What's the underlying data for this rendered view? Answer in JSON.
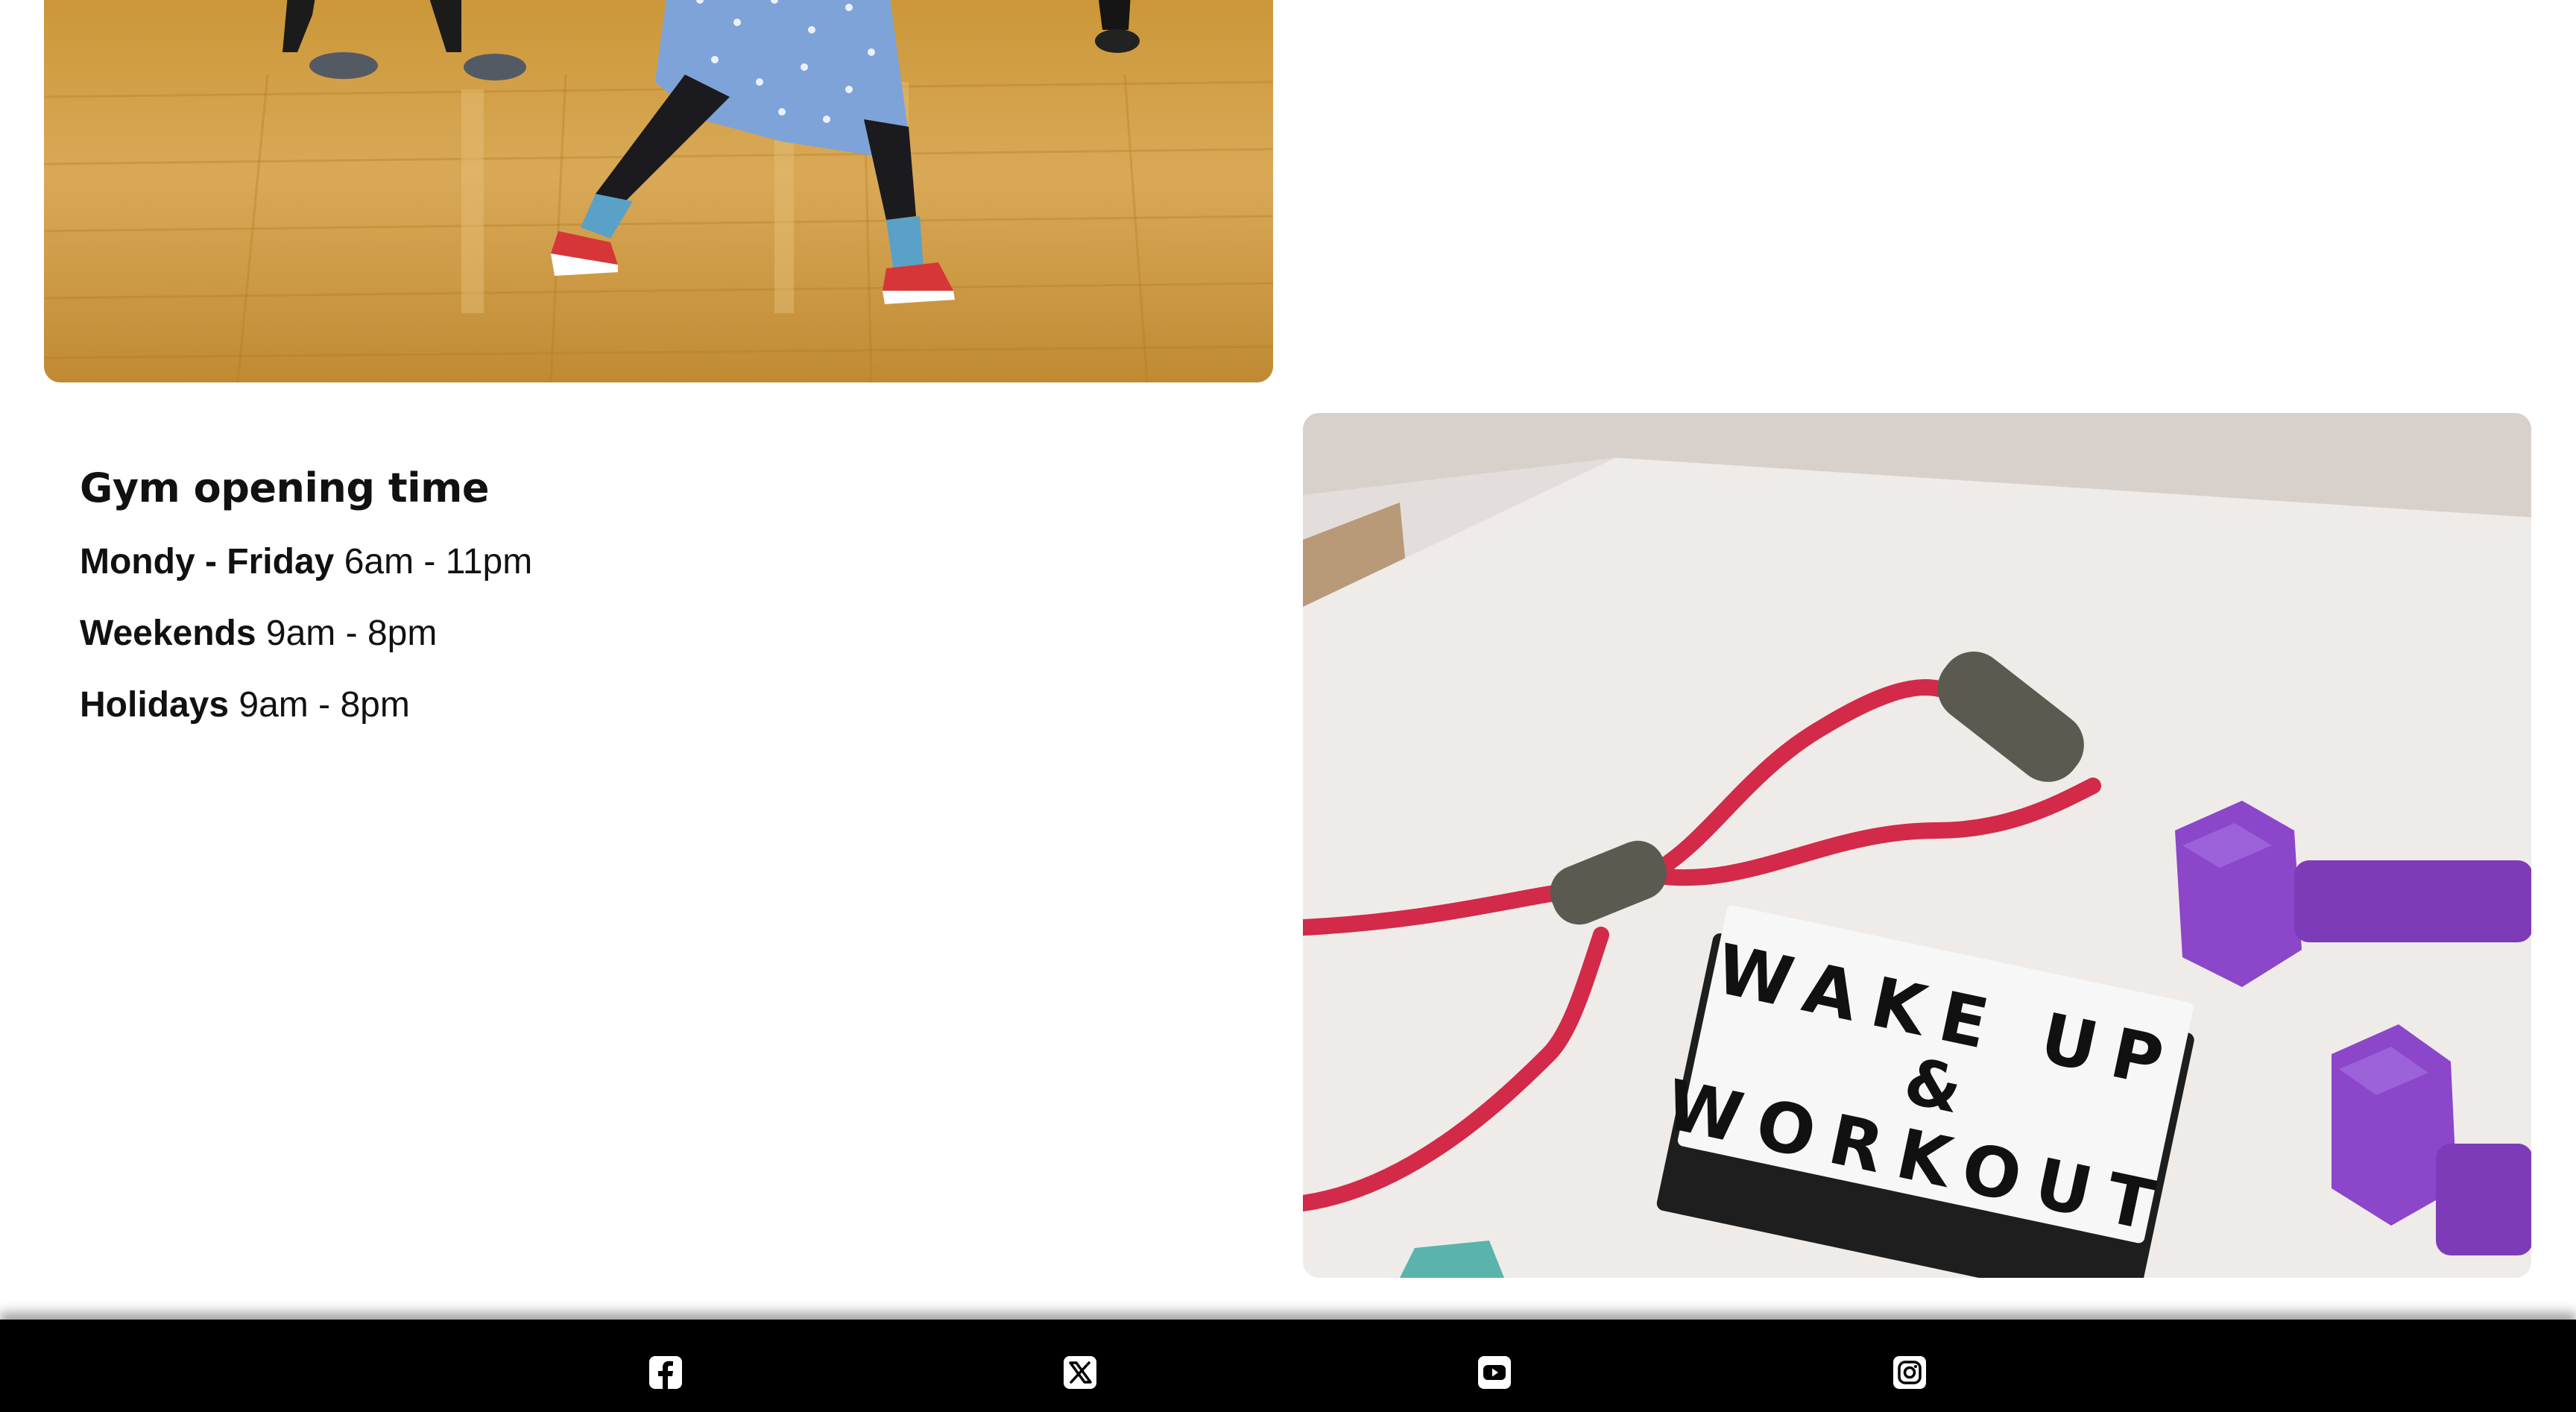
{
  "hours": {
    "title": "Gym opening time",
    "rows": [
      {
        "day": "Mondy - Friday",
        "time": "6am - 11pm"
      },
      {
        "day": "Weekends",
        "time": "9am - 8pm"
      },
      {
        "day": "Holidays",
        "time": "9am - 8pm"
      }
    ]
  },
  "images": {
    "workout_sign_line1": "WAKE UP",
    "workout_sign_line2": "&",
    "workout_sign_line3": "WORKOUT"
  },
  "footer": {
    "icons": [
      "facebook-icon",
      "x-twitter-icon",
      "youtube-icon",
      "instagram-icon"
    ]
  },
  "colors": {
    "footer_bg": "#000000",
    "text": "#111111"
  }
}
